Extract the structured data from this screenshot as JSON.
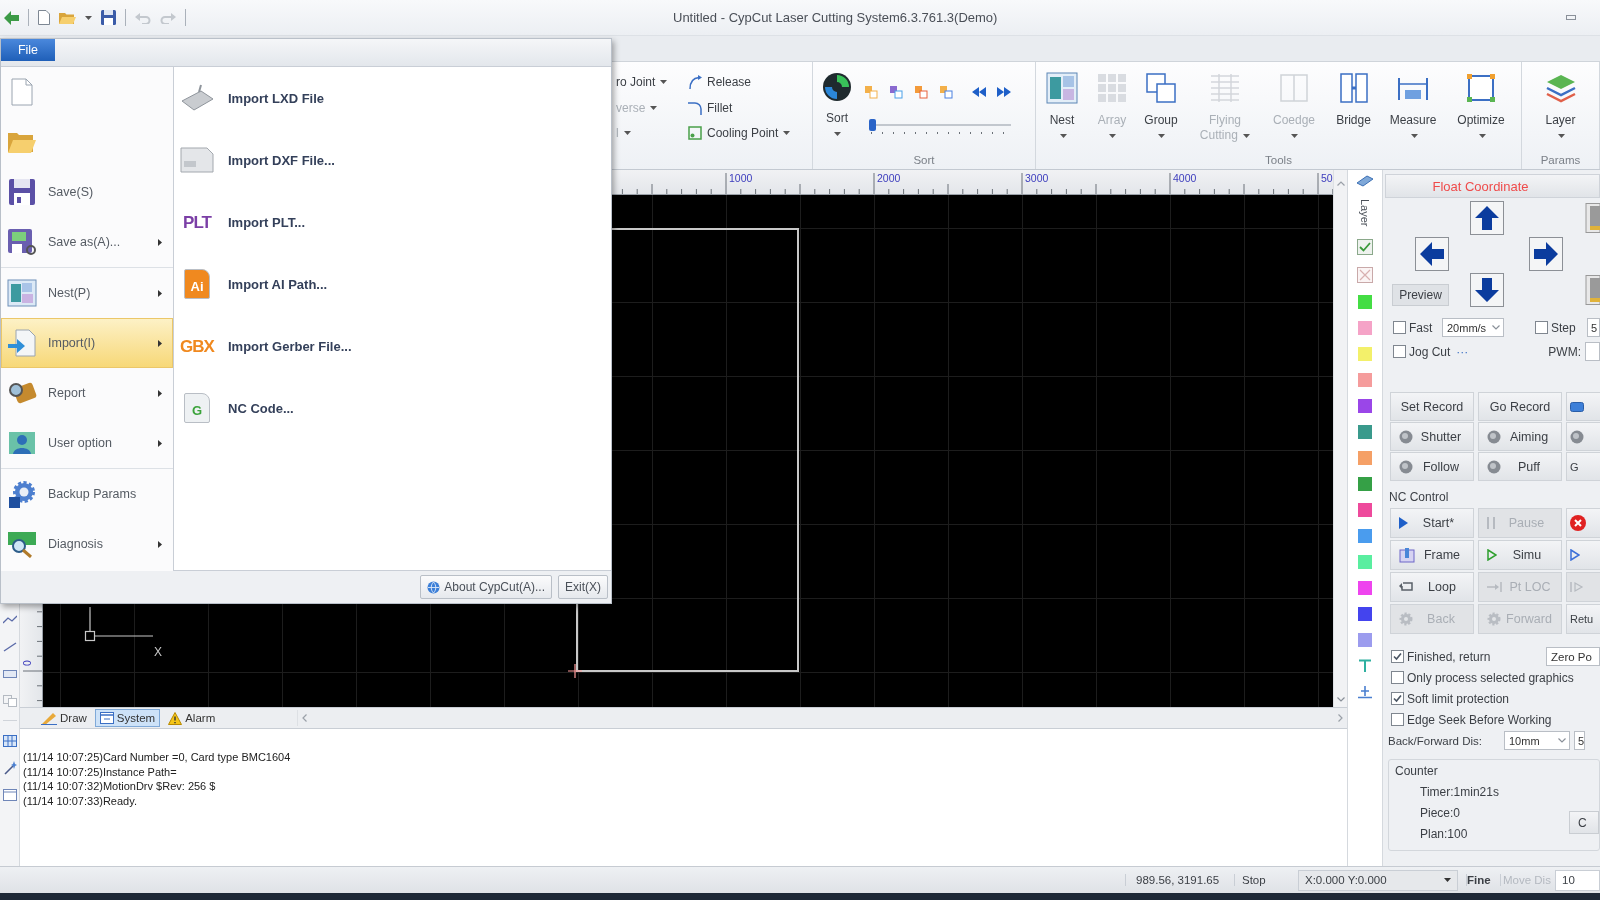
{
  "window": {
    "title": "Untitled - CypCut Laser Cutting System6.3.761.3(Demo)"
  },
  "file_menu": {
    "tab": "File",
    "sections": [
      [
        {
          "selected": false,
          "submenu": false
        },
        {
          "selected": false,
          "submenu": false
        },
        {
          "label": "Save(S)",
          "selected": false,
          "submenu": false
        },
        {
          "label": "Save as(A)...",
          "selected": false,
          "submenu": true
        }
      ],
      [
        {
          "label": "Nest(P)",
          "selected": false,
          "submenu": true
        },
        {
          "label": "Import(I)",
          "selected": true,
          "submenu": true
        },
        {
          "label": "Report",
          "selected": false,
          "submenu": true
        },
        {
          "label": "User option",
          "selected": false,
          "submenu": true
        }
      ],
      [
        {
          "label": "Backup Params",
          "selected": false,
          "submenu": false
        },
        {
          "label": "Diagnosis",
          "selected": false,
          "submenu": true
        }
      ]
    ],
    "submenu": [
      {
        "kind": "icon",
        "label": "Import LXD File"
      },
      {
        "kind": "icon",
        "label": "Import DXF File..."
      },
      {
        "kind": "letters",
        "icon_text": "PLT",
        "label": "Import PLT..."
      },
      {
        "kind": "document",
        "icon_text": "Ai",
        "label": "Import AI Path..."
      },
      {
        "kind": "letters",
        "icon_text": "GBX",
        "label": "Import Gerber File..."
      },
      {
        "kind": "document",
        "icon_text": "G",
        "label": "NC Code..."
      }
    ],
    "footer_buttons": [
      "About CypCut(A)...",
      "Exit(X)"
    ]
  },
  "ribbon": {
    "groups": [
      {
        "kind": "columns",
        "columns": [
          [
            {
              "label": "ro Joint",
              "dropdown": true,
              "disabled": false
            },
            {
              "label": "verse",
              "dropdown": true,
              "disabled": true
            },
            {
              "label": "l",
              "dropdown": true,
              "disabled": true
            }
          ],
          [
            {
              "label": "Release",
              "dropdown": false,
              "disabled": false
            },
            {
              "label": "Fillet",
              "dropdown": false,
              "disabled": false
            },
            {
              "label": "Cooling Point",
              "dropdown": true,
              "disabled": false
            }
          ]
        ]
      },
      {
        "kind": "sort",
        "label": "Sort",
        "button": {
          "label": "Sort",
          "dropdown": true
        },
        "slider": {
          "level": 0
        }
      },
      {
        "kind": "large",
        "label": "Tools",
        "buttons": [
          {
            "label": "Nest",
            "dropdown": true,
            "disabled": false
          },
          {
            "label": "Array",
            "dropdown": true,
            "disabled": true
          },
          {
            "label": "Group",
            "dropdown": true,
            "disabled": false
          },
          {
            "label": "Flying Cutting",
            "dropdown": true,
            "disabled": true
          },
          {
            "label": "Coedge",
            "dropdown": true,
            "disabled": true
          },
          {
            "label": "Bridge",
            "dropdown": false,
            "disabled": false
          },
          {
            "label": "Measure",
            "dropdown": true,
            "disabled": false
          },
          {
            "label": "Optimize",
            "dropdown": true,
            "disabled": false
          }
        ]
      },
      {
        "kind": "large",
        "label": "Params",
        "buttons": [
          {
            "label": "Layer",
            "dropdown": true,
            "disabled": false
          }
        ]
      }
    ]
  },
  "canvas": {
    "ruler_labels": [
      "1000",
      "2000",
      "3000",
      "4000",
      "50"
    ],
    "vertical_ruler_label": "0",
    "axis_label": "X"
  },
  "layer_panel": {
    "title": "Layer",
    "swatches": [
      {
        "color": "#44dd44"
      },
      {
        "color": "#f5a3c7"
      },
      {
        "color": "#f3f06a"
      },
      {
        "color": "#f59c9c"
      },
      {
        "color": "#9a46e8"
      },
      {
        "color": "#3a9a8c"
      },
      {
        "color": "#f5a066"
      },
      {
        "color": "#35a046"
      },
      {
        "color": "#ee4a9c"
      },
      {
        "color": "#4a9cee"
      },
      {
        "color": "#5aeea0"
      },
      {
        "color": "#ee44ee"
      },
      {
        "color": "#4444ee"
      },
      {
        "color": "#9c9cee"
      }
    ]
  },
  "control_panel": {
    "title": "Float Coordinate",
    "preview": "Preview",
    "fast": {
      "label": "Fast",
      "checked": false,
      "value": "20mm/s"
    },
    "step": {
      "label": "Step",
      "checked": false,
      "value": "5"
    },
    "jog_cut": {
      "label": "Jog Cut",
      "checked": false,
      "more": "···"
    },
    "pwm_label": "PWM:",
    "record_rows": [
      [
        {
          "label": "Set Record",
          "disabled": false
        },
        {
          "label": "Go Record",
          "disabled": false
        },
        {
          "disabled": false
        }
      ],
      [
        {
          "label": "Shutter",
          "disabled": false
        },
        {
          "label": "Aiming",
          "disabled": false
        },
        {
          "disabled": false
        }
      ],
      [
        {
          "label": "Follow",
          "disabled": false
        },
        {
          "label": "Puff",
          "disabled": false
        },
        {
          "label": "G",
          "disabled": false
        }
      ]
    ],
    "nc_label": "NC Control",
    "nc_rows": [
      [
        {
          "label": "Start*",
          "disabled": false
        },
        {
          "label": "Pause",
          "disabled": true
        },
        {
          "disabled": false
        }
      ],
      [
        {
          "label": "Frame",
          "disabled": false
        },
        {
          "label": "Simu",
          "disabled": false
        },
        {
          "disabled": false
        }
      ],
      [
        {
          "label": "Loop",
          "disabled": false
        },
        {
          "label": "Pt LOC",
          "disabled": true
        },
        {
          "disabled": true
        }
      ],
      [
        {
          "label": "Back",
          "disabled": true
        },
        {
          "label": "Forward",
          "disabled": true
        },
        {
          "label": "Retu",
          "disabled": false
        }
      ]
    ],
    "options": [
      {
        "label": "Finished, return",
        "checked": true
      },
      {
        "label": "Only process selected graphics",
        "checked": false
      },
      {
        "label": "Soft limit protection",
        "checked": true
      },
      {
        "label": "Edge Seek Before Working",
        "checked": false
      }
    ],
    "return_point": "Zero Po",
    "back_forward": {
      "label": "Back/Forward Dis:",
      "value": "10mm",
      "value_2": "5"
    },
    "counter": {
      "title": "Counter",
      "lines": [
        "Timer:1min21s",
        "Piece:0",
        "Plan:100"
      ],
      "button": "C"
    }
  },
  "console": {
    "tabs": [
      {
        "label": "Draw",
        "selected": false
      },
      {
        "label": "System",
        "selected": true
      },
      {
        "label": "Alarm",
        "selected": false
      }
    ],
    "log": [
      "(11/14 10:07:25)Card Number =0, Card type BMC1604",
      "(11/14 10:07:25)Instance Path=",
      "(11/14 10:07:32)MotionDrv $Rev: 256 $",
      "(11/14 10:07:33)Ready."
    ]
  },
  "status_bar": {
    "position": "989.56, 3191.65",
    "state": "Stop",
    "coordinate": "X:0.000 Y:0.000",
    "mode": "Fine",
    "move_dis": {
      "label": "Move Dis",
      "disabled": true,
      "value": "10"
    }
  }
}
